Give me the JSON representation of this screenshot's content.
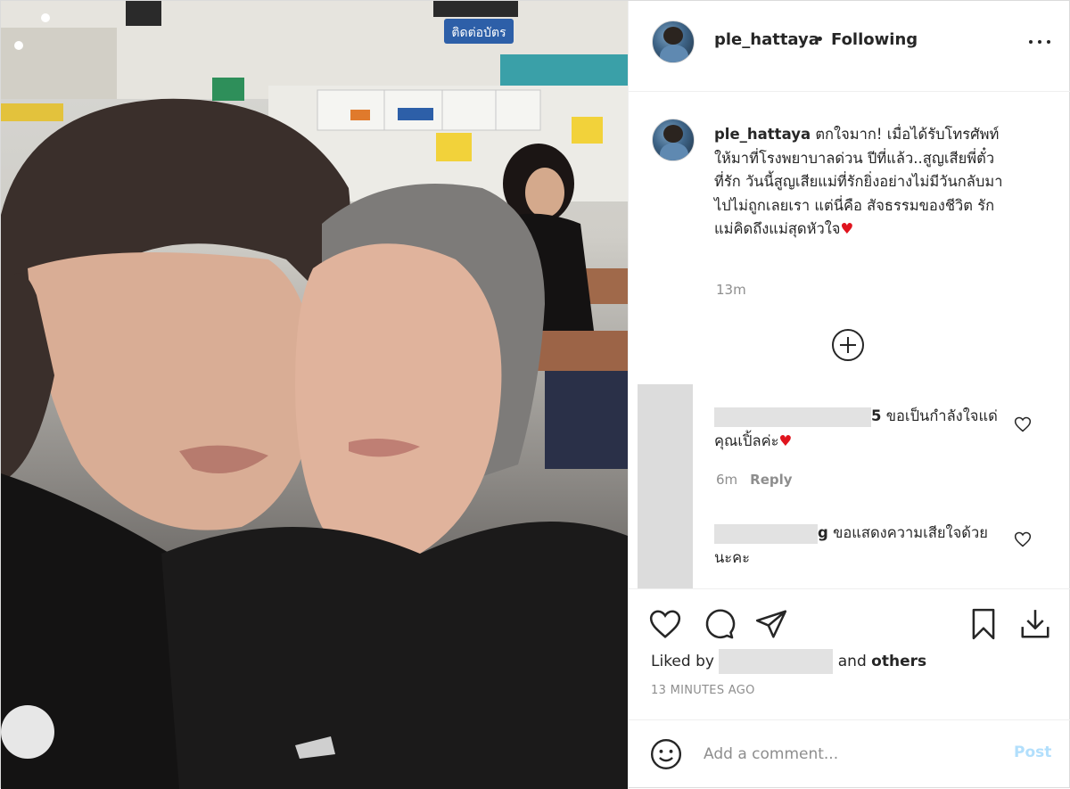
{
  "header": {
    "username": "ple_hattaya",
    "separator": "•",
    "follow_status": "Following"
  },
  "caption": {
    "username": "ple_hattaya",
    "text": "ตกใจมาก! เมื่อได้รับโทรศัพท์ให้มาที่โรงพยาบาลด่วน ปีที่แล้ว..สูญเสียพี่ตั๋วที่รัก วันนี้สูญเสียแม่ที่รักยิ่งอย่างไม่มีวันกลับมา ไปไม่ถูกเลยเรา แต่นี่คือ สัจธรรมของชีวิต รักแม่คิดถึงแม่สุดหัวใจ",
    "heart": "♥",
    "time": "13m"
  },
  "comments": [
    {
      "username_tail": "5",
      "text": "ขอเป็นกำลังใจแด่คุณเปิ้ลค่ะ",
      "heart": "♥",
      "time": "6m",
      "reply_label": "Reply"
    },
    {
      "username_tail": "g",
      "text": "ขอแสดงความเสียใจด้วยนะคะ"
    }
  ],
  "likes": {
    "prefix": "Liked by",
    "suffix_and": "and",
    "suffix_others": "others"
  },
  "timestamp": "13 MINUTES AGO",
  "add_comment": {
    "placeholder": "Add a comment...",
    "post_label": "Post"
  },
  "photo": {
    "sign_text": "ติดต่อบัตร"
  },
  "icons": [
    "more-icon",
    "load-more-icon",
    "heart-icon",
    "comment-icon",
    "share-icon",
    "bookmark-icon",
    "download-icon",
    "emoji-icon"
  ],
  "colors": {
    "accent_disabled": "#b2dffc",
    "muted": "#8e8e8e",
    "text": "#262626",
    "heart": "#e0141e"
  }
}
